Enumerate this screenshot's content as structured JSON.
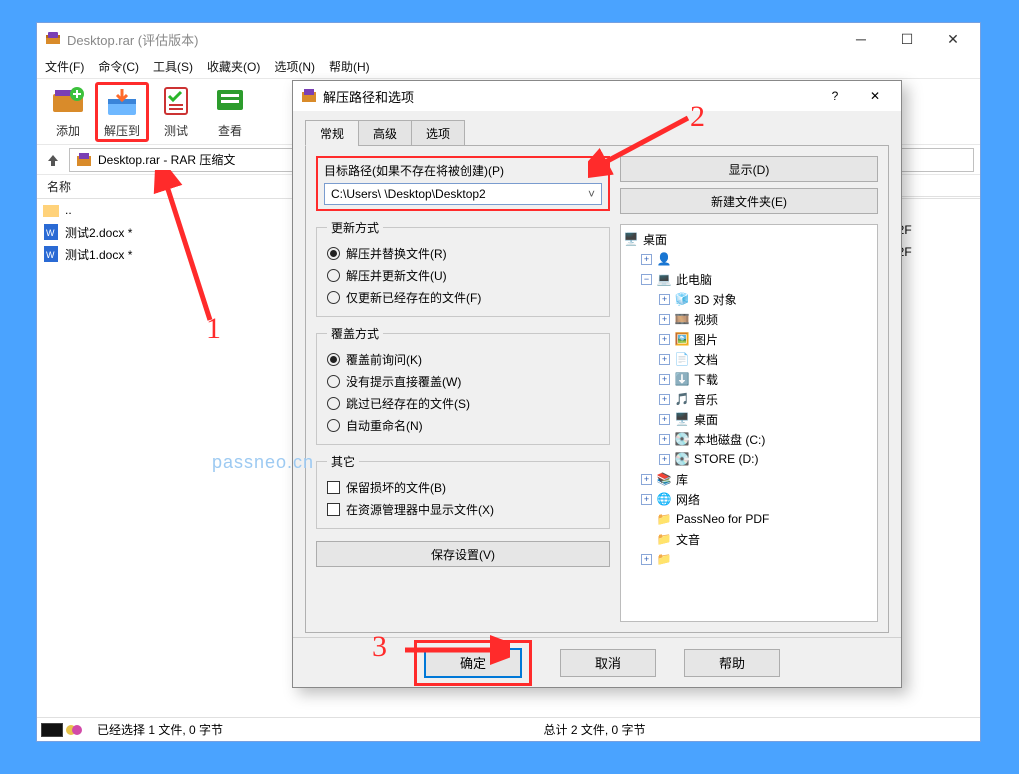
{
  "main_window": {
    "title": "Desktop.rar (评估版本)",
    "menu": [
      "文件(F)",
      "命令(C)",
      "工具(S)",
      "收藏夹(O)",
      "选项(N)",
      "帮助(H)"
    ],
    "toolbar": {
      "add": "添加",
      "extract_to": "解压到",
      "test": "测试",
      "view": "查看"
    },
    "path_text": "Desktop.rar - RAR 压缩文",
    "list_header": {
      "name": "名称"
    },
    "files": {
      "up": "..",
      "f1": "测试2.docx *",
      "f2": "测试1.docx *",
      "date1": "72F",
      "date2": "72F"
    },
    "status_left": "已经选择 1 文件, 0 字节",
    "status_right": "总计 2 文件, 0 字节"
  },
  "dialog": {
    "title": "解压路径和选项",
    "help_q": "?",
    "tabs": {
      "general": "常规",
      "advanced": "高级",
      "options": "选项"
    },
    "path_label": "目标路径(如果不存在将被创建)(P)",
    "path_value": "C:\\Users\\            \\Desktop\\Desktop2",
    "show_btn": "显示(D)",
    "new_folder_btn": "新建文件夹(E)",
    "update": {
      "legend": "更新方式",
      "r1": "解压并替换文件(R)",
      "r2": "解压并更新文件(U)",
      "r3": "仅更新已经存在的文件(F)"
    },
    "overwrite": {
      "legend": "覆盖方式",
      "r1": "覆盖前询问(K)",
      "r2": "没有提示直接覆盖(W)",
      "r3": "跳过已经存在的文件(S)",
      "r4": "自动重命名(N)"
    },
    "other": {
      "legend": "其它",
      "c1": "保留损坏的文件(B)",
      "c2": "在资源管理器中显示文件(X)"
    },
    "save_settings": "保存设置(V)",
    "tree": {
      "desktop": "桌面",
      "user_masked": "",
      "this_pc": "此电脑",
      "obj3d": "3D 对象",
      "videos": "视频",
      "pictures": "图片",
      "documents": "文档",
      "downloads": "下载",
      "music": "音乐",
      "desk2": "桌面",
      "disk_c": "本地磁盘 (C:)",
      "disk_d": "STORE (D:)",
      "libraries": "库",
      "network": "网络",
      "passneo": "PassNeo for PDF",
      "wenyin": "文音",
      "more": ""
    },
    "ok": "确定",
    "cancel": "取消",
    "help": "帮助"
  },
  "annotations": {
    "n1": "1",
    "n2": "2",
    "n3": "3",
    "watermark": "passneo.cn"
  }
}
